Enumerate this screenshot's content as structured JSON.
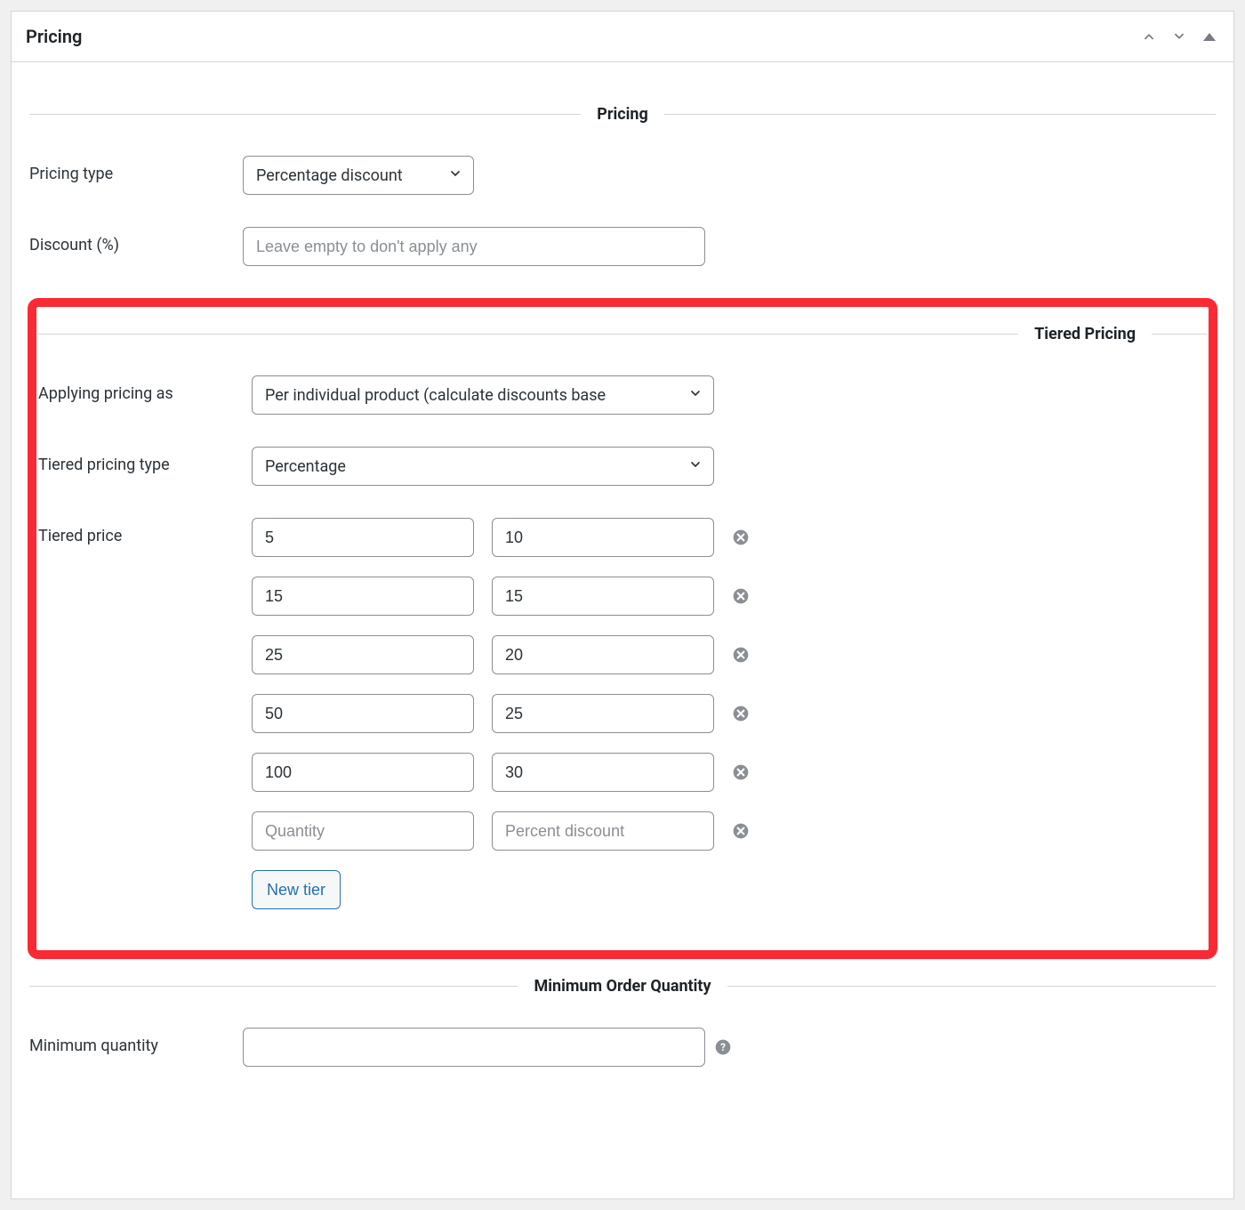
{
  "panel": {
    "title": "Pricing"
  },
  "sections": {
    "pricing": {
      "title": "Pricing"
    },
    "tiered": {
      "title": "Tiered Pricing"
    },
    "minqty": {
      "title": "Minimum Order Quantity"
    }
  },
  "fields": {
    "pricing_type": {
      "label": "Pricing type",
      "value": "Percentage discount"
    },
    "discount_pct": {
      "label": "Discount (%)",
      "placeholder": "Leave empty to don't apply any",
      "value": ""
    },
    "applying_as": {
      "label": "Applying pricing as",
      "value": "Per individual product (calculate discounts base"
    },
    "tiered_type": {
      "label": "Tiered pricing type",
      "value": "Percentage"
    },
    "tiered_price": {
      "label": "Tiered price"
    },
    "min_qty": {
      "label": "Minimum quantity",
      "value": ""
    }
  },
  "tier_placeholder": {
    "qty": "Quantity",
    "val": "Percent discount"
  },
  "tiers": [
    {
      "qty": "5",
      "val": "10"
    },
    {
      "qty": "15",
      "val": "15"
    },
    {
      "qty": "25",
      "val": "20"
    },
    {
      "qty": "50",
      "val": "25"
    },
    {
      "qty": "100",
      "val": "30"
    },
    {
      "qty": "",
      "val": ""
    }
  ],
  "buttons": {
    "new_tier": "New tier"
  }
}
